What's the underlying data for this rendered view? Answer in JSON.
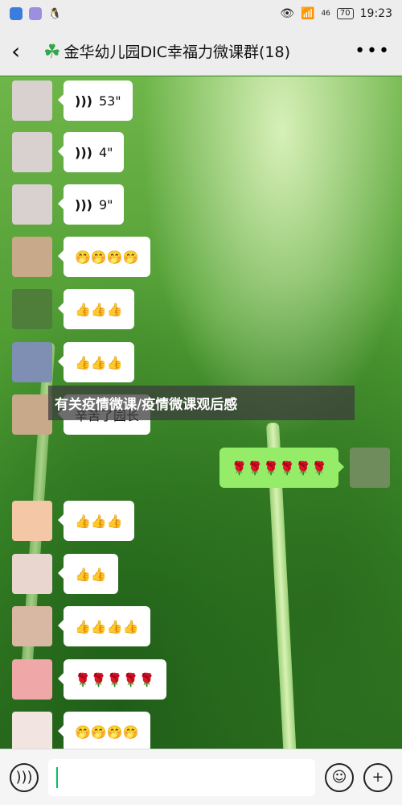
{
  "status": {
    "time": "19:23",
    "signal_label": "46",
    "battery": "70"
  },
  "header": {
    "back_icon": "‹",
    "group_icon": "clover-icon",
    "title": "金华幼儿园DIC幸福力微课群(18)",
    "more_icon": "•••"
  },
  "messages": [
    {
      "type": "voice",
      "text": "53\"",
      "avatar_color": "#d9d1cf"
    },
    {
      "type": "voice",
      "text": "4\"",
      "avatar_color": "#d9d1cf"
    },
    {
      "type": "voice",
      "text": "9\"",
      "avatar_color": "#d9d1cf"
    },
    {
      "type": "emoji",
      "text": "🤭🤭🤭🤭",
      "avatar_color": "#c8a98a"
    },
    {
      "type": "emoji",
      "text": "👍👍👍",
      "avatar_color": "#4f7d3a"
    },
    {
      "type": "emoji",
      "text": "👍👍👍",
      "avatar_color": "#7e8fb3"
    },
    {
      "type": "text",
      "text": "辛苦了园长",
      "avatar_color": "#c8a98a"
    },
    {
      "type": "emoji",
      "text": "🌹🌹🌹🌹🌹🌹",
      "avatar_color": "#6f8c5d",
      "mine": true
    },
    {
      "type": "emoji",
      "text": "👍👍👍",
      "avatar_color": "#f4c7a6"
    },
    {
      "type": "emoji",
      "text": "👍👍",
      "avatar_color": "#e9d6cf"
    },
    {
      "type": "emoji",
      "text": "👍👍👍👍",
      "avatar_color": "#d9b8a3"
    },
    {
      "type": "emoji",
      "text": "🌹🌹🌹🌹🌹",
      "avatar_color": "#f0a7a7"
    },
    {
      "type": "emoji",
      "text": "🤭🤭🤭🤭",
      "avatar_color": "#f1e4e1"
    }
  ],
  "overlay_caption": "有关疫情微课/疫情微课观后感",
  "input": {
    "voice_icon": "🔊",
    "emoji_icon": "☺",
    "plus_icon": "+"
  }
}
